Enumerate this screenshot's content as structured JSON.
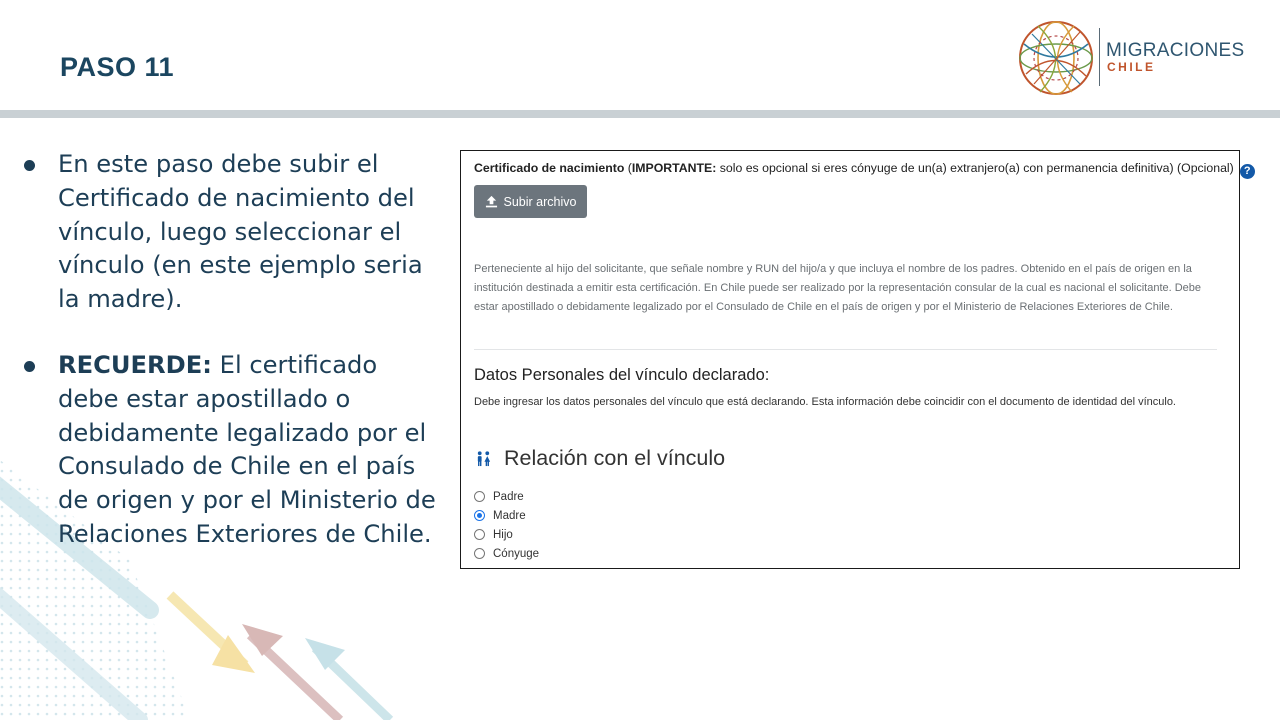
{
  "slide": {
    "title": "PASO 11"
  },
  "logo": {
    "name": "MIGRACIONES",
    "sub": "CHILE"
  },
  "bullets": [
    {
      "strong": "",
      "text": "En este paso debe subir el Certificado de nacimiento del vínculo, luego seleccionar el vínculo (en este ejemplo seria la madre)."
    },
    {
      "strong": "RECUERDE:",
      "text": " El certificado debe estar apostillado o debidamente legalizado por el Consulado de Chile en el país de origen y por el Ministerio de Relaciones Exteriores de Chile."
    }
  ],
  "form": {
    "cert_label": "Certificado de nacimiento",
    "important_label": "IMPORTANTE:",
    "cert_note": " solo es opcional si eres cónyuge de un(a) extranjero(a) con permanencia definitiva) (Opcional)",
    "help_icon": "?",
    "upload_label": "Subir archivo",
    "help_text": "Perteneciente al hijo del solicitante, que señale nombre y RUN del hijo/a y que incluya el nombre de los padres. Obtenido en el país de origen en la institución destinada a emitir esta certificación. En Chile puede ser realizado por la representación consular de la cual es nacional el solicitante. Debe estar apostillado o debidamente legalizado por el Consulado de Chile en el país de origen y por el Ministerio de Relaciones Exteriores de Chile.",
    "section_title": "Datos Personales del vínculo declarado:",
    "section_desc": "Debe ingresar los datos personales del vínculo que está declarando. Esta información debe coincidir con el documento de identidad del vínculo.",
    "relation_title": "Relación con el vínculo",
    "relation_options": [
      "Padre",
      "Madre",
      "Hijo",
      "Cónyuge"
    ],
    "selected_relation": "Madre"
  },
  "icons": {
    "upload": "upload-icon",
    "help": "question-circle-icon",
    "relation": "people-icon"
  },
  "colors": {
    "title": "#1b4660",
    "body_text": "#1d3e56",
    "header_bar": "#c9d0d4",
    "upload_button": "#6c757d",
    "help_icon": "#1359a8",
    "radio_checked": "#1a73e8",
    "logo_sub": "#c0552d"
  }
}
